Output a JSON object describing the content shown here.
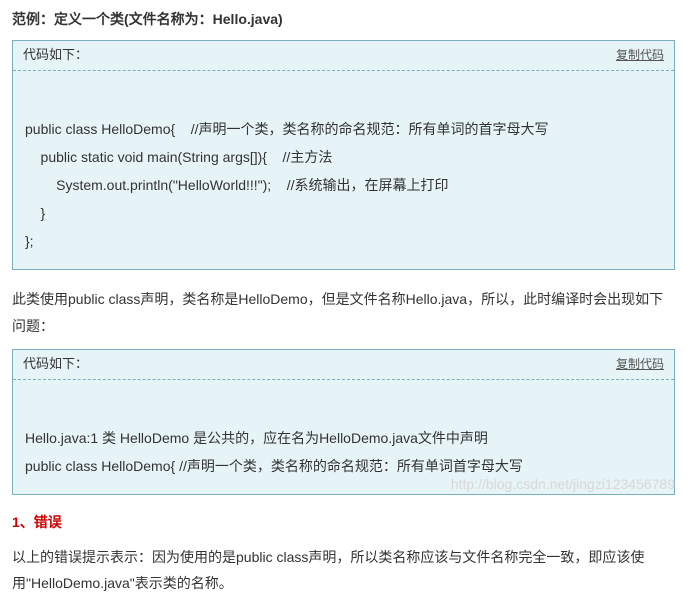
{
  "exampleTitle": "范例：定义一个类(文件名称为：Hello.java)",
  "codeBox1": {
    "label": "代码如下：",
    "copy": "复制代码",
    "body": "\npublic class HelloDemo{    //声明一个类，类名称的命名规范：所有单词的首字母大写\n    public static void main(String args[]){    //主方法\n        System.out.println(\"HelloWorld!!!\");    //系统输出，在屏幕上打印\n    }\n};"
  },
  "paragraph1": "此类使用public class声明，类名称是HelloDemo，但是文件名称Hello.java，所以，此时编译时会出现如下问题：",
  "codeBox2": {
    "label": "代码如下：",
    "copy": "复制代码",
    "body": "\nHello.java:1 类 HelloDemo 是公共的，应在名为HelloDemo.java文件中声明\npublic class HelloDemo{ //声明一个类，类名称的命名规范：所有单词首字母大写"
  },
  "errorHeading": "1、错误",
  "paragraph2": "以上的错误提示表示：因为使用的是public class声明，所以类名称应该与文件名称完全一致，即应该使用\"HelloDemo.java\"表示类的名称。",
  "watermark": "http://blog.csdn.net/jingzi123456789"
}
